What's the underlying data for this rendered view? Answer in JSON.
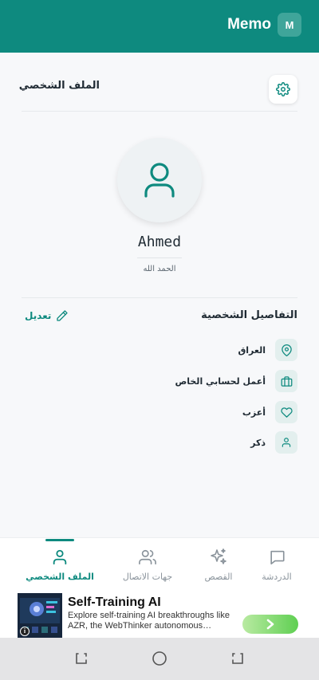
{
  "header": {
    "title": "Memo",
    "badge": "M"
  },
  "profile": {
    "page_title": "الملف الشخصي",
    "name": "Ahmed",
    "bio": "الحمد الله",
    "details_title": "التفاصيل الشخصية",
    "edit_label": "تعديل",
    "details": [
      {
        "icon": "location-pin-icon",
        "text": "العراق"
      },
      {
        "icon": "briefcase-icon",
        "text": "أعمل لحسابي الخاص"
      },
      {
        "icon": "heart-icon",
        "text": "أعزب"
      },
      {
        "icon": "person-icon",
        "text": "ذكر"
      }
    ]
  },
  "bottom_nav": {
    "items": [
      {
        "icon": "chat-bubble-icon",
        "label": "الدردشة",
        "active": false
      },
      {
        "icon": "sparkles-icon",
        "label": "القصص",
        "active": false
      },
      {
        "icon": "contacts-icon",
        "label": "جهات الاتصال",
        "active": false
      },
      {
        "icon": "user-icon",
        "label": "الملف الشخصي",
        "active": true
      }
    ]
  },
  "ad": {
    "title": "Self-Training AI",
    "description": "Explore self-training AI breakthroughs like AZR, the WebThinker autonomous…",
    "info_glyph": "i"
  },
  "colors": {
    "primary": "#0e8a7f",
    "header_badge": "#3fa59a",
    "icon_bg": "#e3efee"
  }
}
